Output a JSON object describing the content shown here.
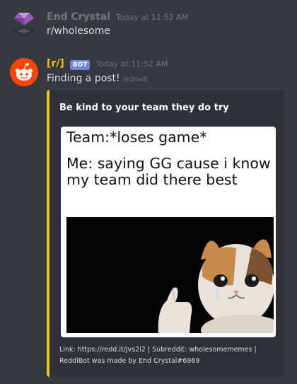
{
  "messages": [
    {
      "username": "End Crystal",
      "timestamp": "Today at 11:52 AM",
      "text": "r/wholesome",
      "username_color": "#72767d",
      "avatar_icon": "purple-crystal-icon"
    },
    {
      "username": "[r/]",
      "bot_tag": "BOT",
      "timestamp": "Today at 11:52 AM",
      "text": "Finding a post!",
      "edited": "(edited)",
      "username_color": "#f1c40f",
      "avatar_icon": "reddit-alien-icon"
    }
  ],
  "embed": {
    "title": "Be kind to your team they do try",
    "accent_color": "#f1c40f",
    "meme_text": {
      "line1": "Team:*loses game*",
      "line2": "Me: saying GG cause i know my team did there best"
    },
    "footer": {
      "line1": "Link: https://redd.it/jvs2i2 |  Subreddit: wholesomememes |",
      "line2": "ReddiBot was made by End Crystal#6969"
    }
  }
}
